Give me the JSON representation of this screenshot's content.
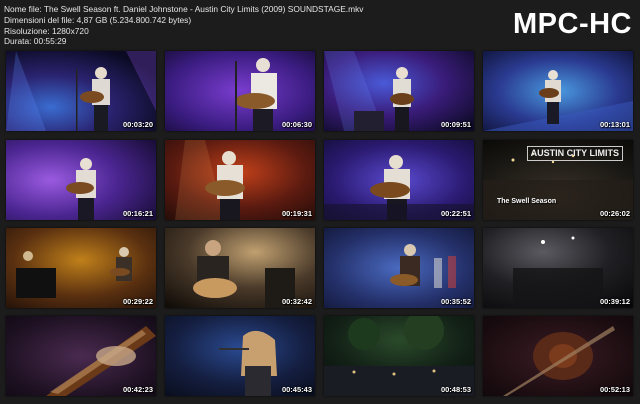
{
  "info": {
    "file_name": "Nome file: The Swell Season ft. Daniel Johnstone - Austin City Limits (2009) SOUNDSTAGE.mkv",
    "file_size": "Dimensioni del file: 4,87 GB (5.234.800.742 bytes)",
    "resolution": "Risoluzione: 1280x720",
    "duration": "Durata: 00:55:29"
  },
  "brand": "MPC-HC",
  "thumbnails": [
    {
      "time": "00:03:20",
      "palette": "blue-purple"
    },
    {
      "time": "00:06:30",
      "palette": "purple"
    },
    {
      "time": "00:09:51",
      "palette": "blue-purple"
    },
    {
      "time": "00:13:01",
      "palette": "blue"
    },
    {
      "time": "00:16:21",
      "palette": "purple"
    },
    {
      "time": "00:19:31",
      "palette": "red-orange"
    },
    {
      "time": "00:22:51",
      "palette": "blue-purple"
    },
    {
      "time": "00:26:02",
      "palette": "dark",
      "overlay": "The Swell Season",
      "logo": "AUSTIN CITY LIMITS"
    },
    {
      "time": "00:29:22",
      "palette": "warm"
    },
    {
      "time": "00:32:42",
      "palette": "warm-dark"
    },
    {
      "time": "00:35:52",
      "palette": "blue"
    },
    {
      "time": "00:39:12",
      "palette": "dark"
    },
    {
      "time": "00:42:23",
      "palette": "dark-purple"
    },
    {
      "time": "00:45:43",
      "palette": "blue-dark"
    },
    {
      "time": "00:48:53",
      "palette": "green-dark"
    },
    {
      "time": "00:52:13",
      "palette": "dark-red"
    }
  ]
}
